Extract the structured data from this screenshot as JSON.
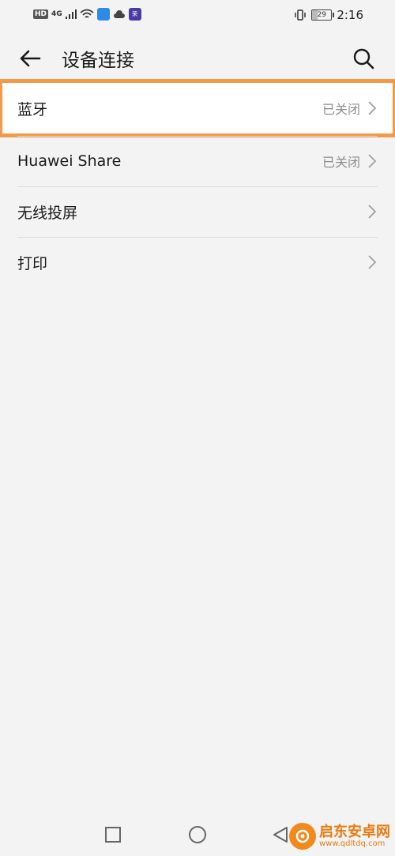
{
  "status_bar": {
    "hd": "HD",
    "network": "4G",
    "app_badge": "荣",
    "battery": "29",
    "battery_level_percent": 29,
    "time": "2:16"
  },
  "header": {
    "title": "设备连接"
  },
  "list": {
    "items": [
      {
        "label": "蓝牙",
        "status": "已关闭"
      },
      {
        "label": "Huawei Share",
        "status": "已关闭"
      },
      {
        "label": "无线投屏",
        "status": ""
      },
      {
        "label": "打印",
        "status": ""
      }
    ]
  },
  "watermark": {
    "title": "启东安卓网",
    "url": "www.qdltdq.com"
  },
  "colors": {
    "background": "#f3f3f3",
    "highlight_border": "#f29a4a",
    "status_text": "#8c8c8c",
    "watermark": "#e87a10"
  },
  "icons": {
    "back": "arrow-left-icon",
    "search": "search-icon",
    "chevron": "chevron-right-icon",
    "nav_recent": "square-icon",
    "nav_home": "circle-icon",
    "nav_back": "triangle-left-icon"
  }
}
